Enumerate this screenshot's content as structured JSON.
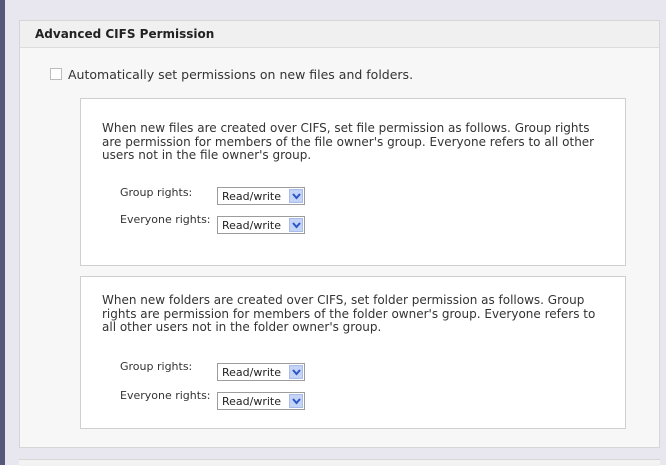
{
  "panel": {
    "title": "Advanced CIFS Permission",
    "auto_checkbox_label": "Automatically set permissions on new files and folders.",
    "auto_checkbox_checked": false
  },
  "files_section": {
    "description": "When new files are created over CIFS, set file permission as follows. Group rights are permission for members of the file owner's group. Everyone refers to all other users not in the file owner's group.",
    "group_label": "Group rights:",
    "group_value": "Read/write",
    "everyone_label": "Everyone rights:",
    "everyone_value": "Read/write"
  },
  "folders_section": {
    "description": "When new folders are created over CIFS, set folder permission as follows. Group rights are permission for members of the folder owner's group. Everyone refers to all other users not in the folder owner's group.",
    "group_label": "Group rights:",
    "group_value": "Read/write",
    "everyone_label": "Everyone rights:",
    "everyone_value": "Read/write"
  },
  "colors": {
    "select_arrow_bg": "#c4d3f6",
    "select_arrow_glyph": "#2a56c6"
  }
}
